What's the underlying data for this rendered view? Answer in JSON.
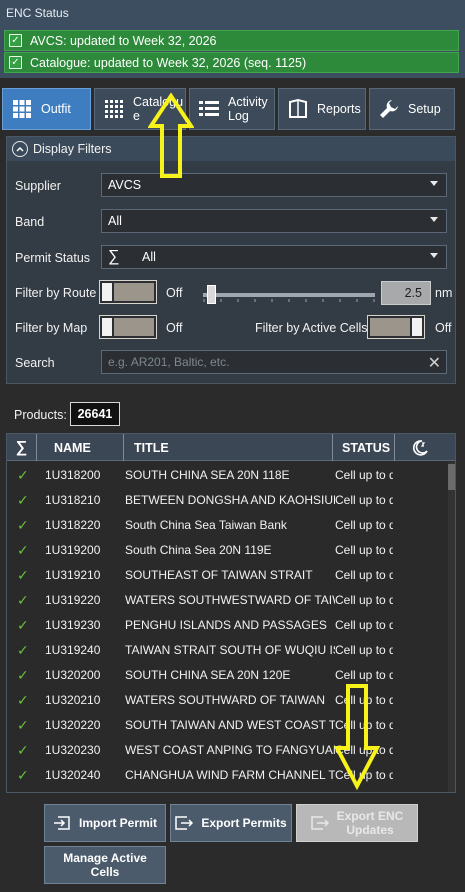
{
  "enc_status": {
    "title": "ENC Status",
    "items": [
      "AVCS: updated to Week 32, 2026",
      "Catalogue: updated to Week 32, 2026 (seq. 1125)"
    ]
  },
  "tabs": [
    {
      "label": "Outfit",
      "icon": "grid-icon",
      "active": true
    },
    {
      "label": "Catalogu\ne",
      "icon": "dotted-grid-icon",
      "active": false
    },
    {
      "label": "Activity\nLog",
      "icon": "list-icon",
      "active": false
    },
    {
      "label": "Reports",
      "icon": "report-icon",
      "active": false
    },
    {
      "label": "Setup",
      "icon": "wrench-icon",
      "active": false
    }
  ],
  "filters": {
    "header": "Display Filters",
    "supplier_label": "Supplier",
    "supplier_value": "AVCS",
    "band_label": "Band",
    "band_value": "All",
    "permit_label": "Permit Status",
    "permit_value": "All",
    "route_label": "Filter by Route",
    "route_state": "Off",
    "route_distance": "2.5",
    "route_unit": "nm",
    "map_label": "Filter by Map",
    "map_state": "Off",
    "active_cells_label": "Filter by Active Cells",
    "active_cells_state": "Off",
    "search_label": "Search",
    "search_placeholder": "e.g. AR201, Baltic, etc."
  },
  "products": {
    "label": "Products:",
    "count": "26641"
  },
  "table": {
    "columns": [
      "∑",
      "NAME",
      "TITLE",
      "STATUS"
    ],
    "rows": [
      {
        "name": "1U318200",
        "title": "SOUTH CHINA SEA 20N 118E",
        "status": "Cell up to date"
      },
      {
        "name": "1U318210",
        "title": "BETWEEN DONGSHA AND KAOHSIUNG",
        "status": "Cell up to date"
      },
      {
        "name": "1U318220",
        "title": "South China Sea Taiwan Bank",
        "status": "Cell up to date"
      },
      {
        "name": "1U319200",
        "title": "South China Sea 20N 119E",
        "status": "Cell up to date"
      },
      {
        "name": "1U319210",
        "title": "SOUTHEAST OF TAIWAN STRAIT",
        "status": "Cell up to date"
      },
      {
        "name": "1U319220",
        "title": "WATERS SOUTHWESTWARD OF TAIWAN",
        "status": "Cell up to date"
      },
      {
        "name": "1U319230",
        "title": "PENGHU ISLANDS AND PASSAGES",
        "status": "Cell up to date"
      },
      {
        "name": "1U319240",
        "title": "TAIWAN STRAIT SOUTH OF WUQIU ISLAND",
        "status": "Cell up to date"
      },
      {
        "name": "1U320200",
        "title": "SOUTH CHINA SEA 20N 120E",
        "status": "Cell up to date"
      },
      {
        "name": "1U320210",
        "title": "WATERS SOUTHWARD OF TAIWAN",
        "status": "Cell up to date"
      },
      {
        "name": "1U320220",
        "title": "SOUTH TAIWAN AND WEST COAST TO",
        "status": "Cell up to date"
      },
      {
        "name": "1U320230",
        "title": "WEST COAST ANPING TO FANGYUAN",
        "status": "Cell up to date"
      },
      {
        "name": "1U320240",
        "title": "CHANGHUA WIND FARM CHANNEL TO",
        "status": "Cell up to date"
      }
    ]
  },
  "buttons": {
    "import_permit": "Import Permit",
    "export_permits": "Export Permits",
    "export_enc_updates": "Export ENC\nUpdates",
    "manage_active_cells": "Manage Active\nCells"
  },
  "colors": {
    "status_green": "#2d8a3a",
    "tab_active": "#3e7ec0",
    "annotation_yellow": "#f7f21a",
    "check_green": "#67c23a"
  }
}
